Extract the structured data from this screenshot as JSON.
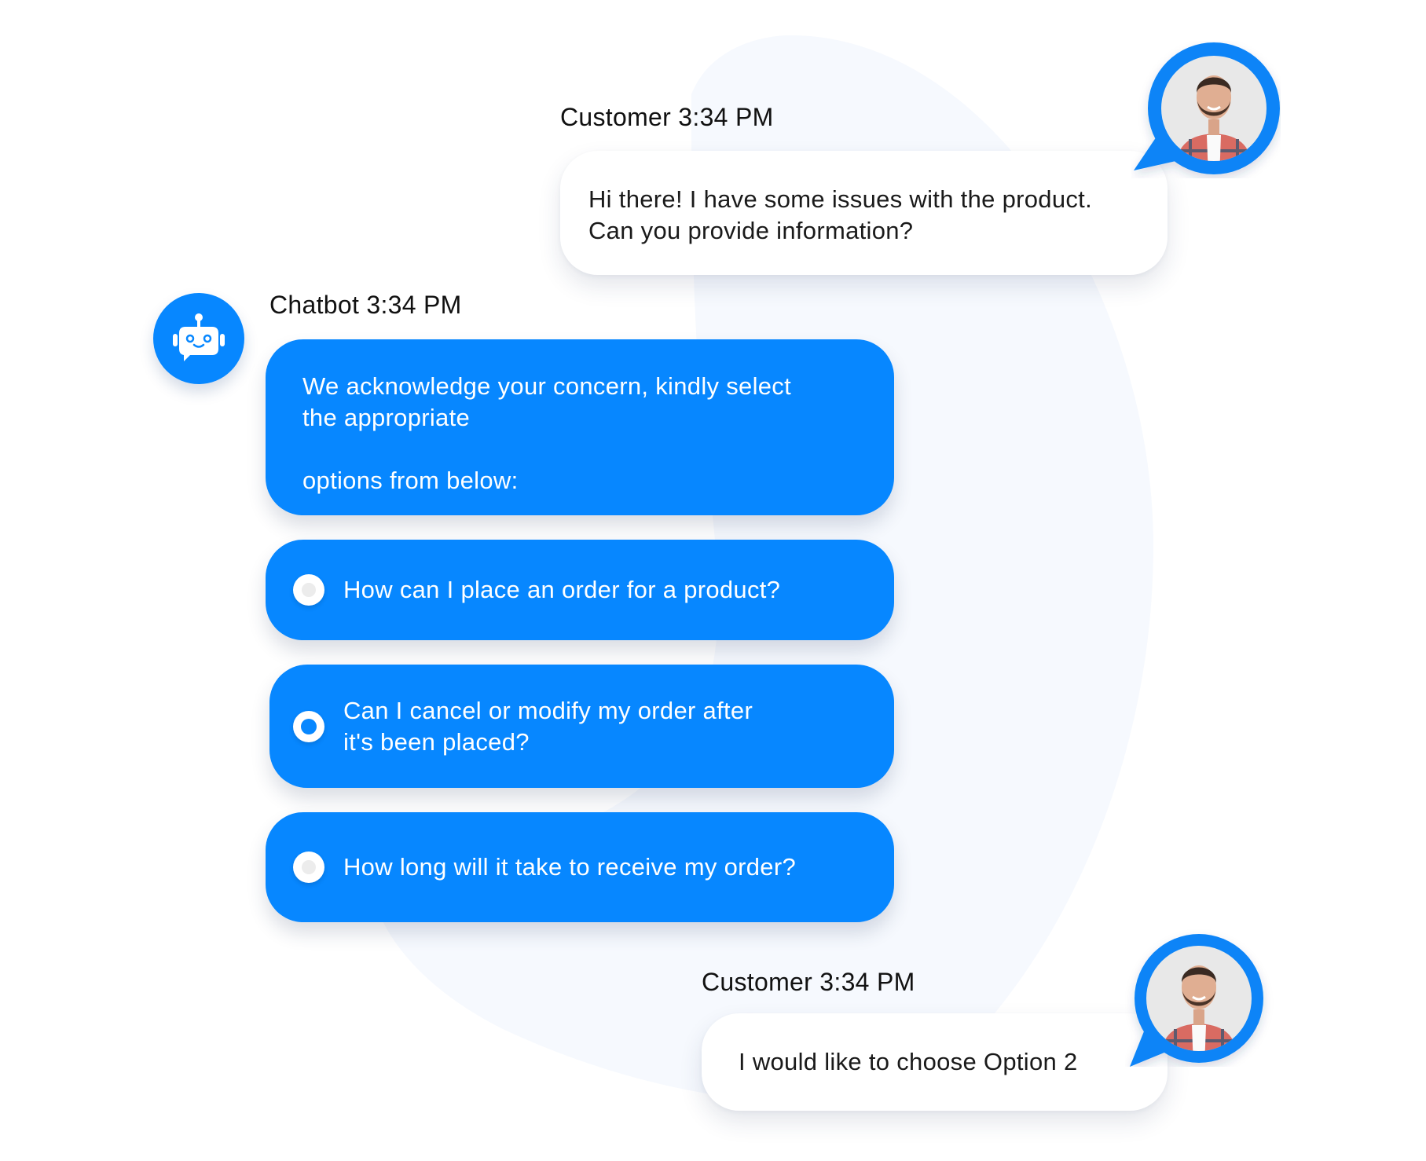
{
  "colors": {
    "accent": "#0787FF",
    "background": "#FFFFFF",
    "blob": "#F6F9FE",
    "bubble_customer": "#FFFFFF",
    "text_dark": "#111111",
    "text_light": "#FFFFFF"
  },
  "messages": [
    {
      "sender": "Customer",
      "header": "Customer 3:34 PM",
      "avatar": "customer-photo-avatar",
      "lines": [
        "Hi there! I have some issues with the product.",
        "Can you provide information?"
      ]
    },
    {
      "sender": "Chatbot",
      "header": "Chatbot 3:34 PM",
      "avatar": "robot-icon",
      "lines": [
        "We acknowledge your concern, kindly select",
        "the appropriate",
        "",
        "options from below:"
      ],
      "options": [
        {
          "lines": [
            "How can I place an order for a product?"
          ],
          "selected": false
        },
        {
          "lines": [
            "Can I cancel or modify my order after",
            "it's been placed?"
          ],
          "selected": true
        },
        {
          "lines": [
            "How long will it take to receive my order?"
          ],
          "selected": false
        }
      ]
    },
    {
      "sender": "Customer",
      "header": "Customer 3:34 PM",
      "avatar": "customer-photo-avatar",
      "lines": [
        "I would like to choose Option 2"
      ]
    }
  ]
}
